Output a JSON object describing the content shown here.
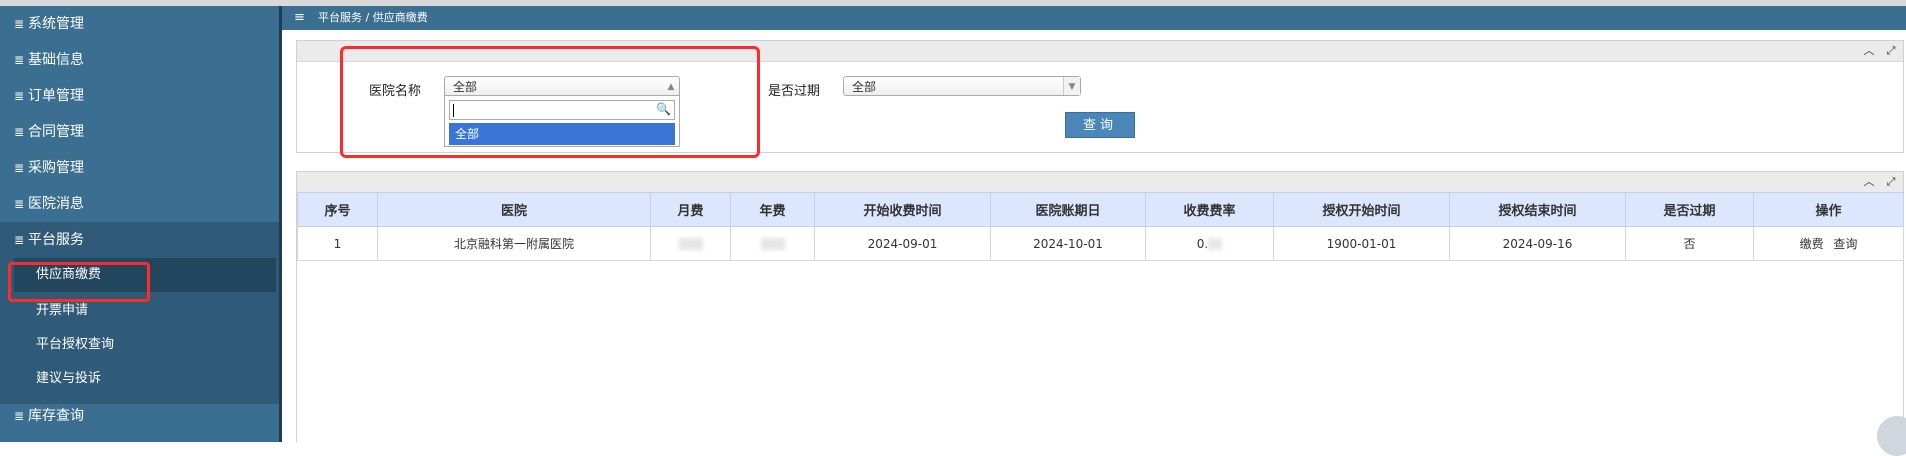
{
  "sidebar": {
    "items": [
      {
        "label": "系统管理"
      },
      {
        "label": "基础信息"
      },
      {
        "label": "订单管理"
      },
      {
        "label": "合同管理"
      },
      {
        "label": "采购管理"
      },
      {
        "label": "医院消息"
      },
      {
        "label": "平台服务"
      },
      {
        "label": "库存查询"
      }
    ],
    "subitems": [
      {
        "label": "供应商缴费"
      },
      {
        "label": "开票申请"
      },
      {
        "label": "平台授权查询"
      },
      {
        "label": "建议与投诉"
      }
    ],
    "menu_icon": "≣"
  },
  "breadcrumb": {
    "icon": "≡",
    "text": "平台服务 / 供应商缴费"
  },
  "filter": {
    "hospital_label": "医院名称",
    "hospital_value": "全部",
    "hospital_search_value": "",
    "hospital_option": "全部",
    "expired_label": "是否过期",
    "expired_value": "全部",
    "query_button": "查询"
  },
  "table": {
    "headers": [
      "序号",
      "医院",
      "月费",
      "年费",
      "开始收费时间",
      "医院账期日",
      "收费费率",
      "授权开始时间",
      "授权结束时间",
      "是否过期",
      "操作"
    ],
    "rows": [
      {
        "index": "1",
        "hospital": "北京融科第一附属医院",
        "monthly_fee": "",
        "annual_fee": "",
        "start_charge": "2024-09-01",
        "billing_day": "2024-10-01",
        "rate": "0.",
        "auth_start": "1900-01-01",
        "auth_end": "2024-09-16",
        "expired": "否",
        "op_pay": "缴费",
        "op_query": "查询"
      }
    ]
  },
  "colors": {
    "sidebar_bg": "#3a6f91",
    "header_row_bg": "#dde6ff",
    "highlight_red": "#ff2a2a",
    "button_blue": "#4a86b8"
  }
}
